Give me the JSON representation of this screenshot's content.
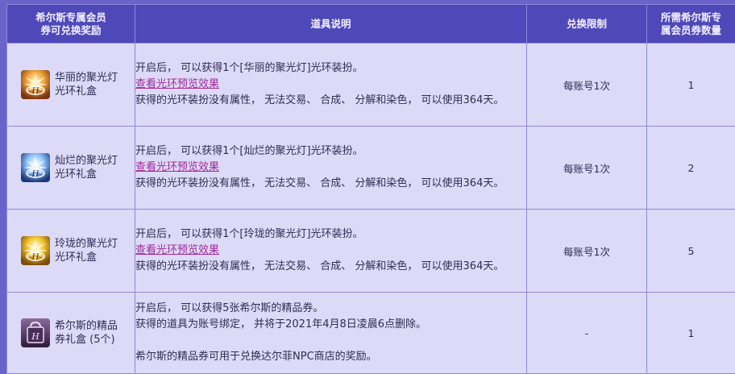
{
  "table": {
    "headers": {
      "reward": "希尔斯专属会员\n券可兑换奖励",
      "description": "道具说明",
      "limit": "兑换限制",
      "cost": "所需希尔斯专\n属会员券数量"
    },
    "rows": [
      {
        "name": "华丽的聚光灯\n光环礼盒",
        "icon": "gold-spotlight-box-icon",
        "desc1": "开启后， 可以获得1个[华丽的聚光灯]光环装扮。",
        "link": "查看光环预览效果",
        "desc2": "获得的光环装扮没有属性， 无法交易、 合成、 分解和染色， 可以使用364天。",
        "limit": "每账号1次",
        "cost": "1"
      },
      {
        "name": "灿烂的聚光灯\n光环礼盒",
        "icon": "blue-spotlight-box-icon",
        "desc1": "开启后， 可以获得1个[灿烂的聚光灯]光环装扮。",
        "link": "查看光环预览效果",
        "desc2": "获得的光环装扮没有属性， 无法交易、 合成、 分解和染色， 可以使用364天。",
        "limit": "每账号1次",
        "cost": "2"
      },
      {
        "name": "玲珑的聚光灯\n光环礼盒",
        "icon": "yellow-spotlight-box-icon",
        "desc1": "开启后， 可以获得1个[玲珑的聚光灯]光环装扮。",
        "link": "查看光环预览效果",
        "desc2": "获得的光环装扮没有属性， 无法交易、 合成、 分解和染色， 可以使用364天。",
        "limit": "每账号1次",
        "cost": "5"
      },
      {
        "name": "希尔斯的精品\n券礼盒 (5个)",
        "icon": "purple-ticket-box-icon",
        "desc1": "开启后， 可以获得5张希尔斯的精品券。",
        "desc2": "获得的道具为账号绑定， 并将于2021年4月8日凌晨6点删除。",
        "desc3": "希尔斯的精品券可用于兑换达尔菲NPC商店的奖励。",
        "limit": "-",
        "cost": "1"
      }
    ]
  },
  "colors": {
    "header_bg": "#4f48b8",
    "cell_bg": "#dcdaf6",
    "border": "#8f89dc",
    "link": "#a3299a"
  }
}
